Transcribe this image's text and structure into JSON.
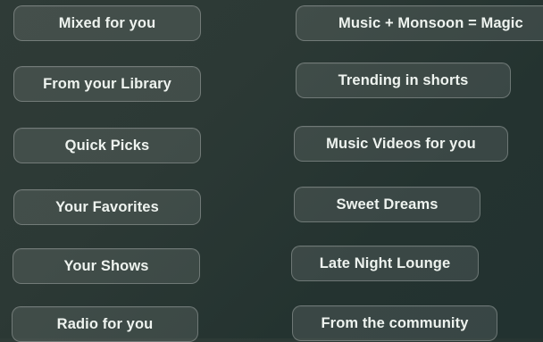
{
  "chips_left": [
    {
      "label": "Mixed for you"
    },
    {
      "label": "From your Library"
    },
    {
      "label": "Quick Picks"
    },
    {
      "label": "Your Favorites"
    },
    {
      "label": "Your Shows"
    },
    {
      "label": "Radio for you"
    }
  ],
  "chips_right": [
    {
      "label": "Music + Monsoon = Magic"
    },
    {
      "label": "Trending in shorts"
    },
    {
      "label": "Music Videos for you"
    },
    {
      "label": "Sweet Dreams"
    },
    {
      "label": "Late Night Lounge"
    },
    {
      "label": "From the community"
    }
  ],
  "colors": {
    "background": "#2c3935",
    "chip_text": "#eef3ef"
  }
}
